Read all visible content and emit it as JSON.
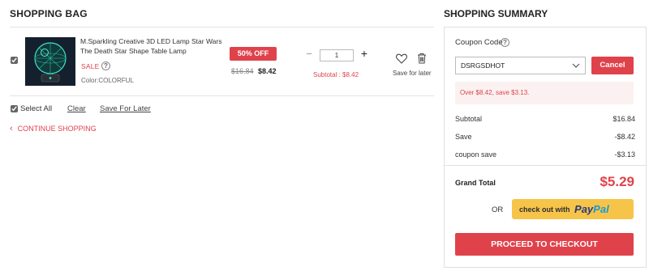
{
  "bag": {
    "title": "SHOPPING BAG",
    "item": {
      "name": "M.Sparkling Creative 3D LED Lamp Star Wars The Death Star Shape Table Lamp",
      "sale_label": "SALE",
      "color": "Color:COLORFUL",
      "discount_badge": "50% OFF",
      "old_price": "$16.84",
      "new_price": "$8.42",
      "quantity": "1",
      "subtotal": "Subtotal : $8.42",
      "save_for_later": "Save for later",
      "checked": true
    },
    "footer": {
      "select_all": "Select All",
      "clear": "Clear",
      "save_for_later": "Save For Later"
    },
    "continue_shopping": "CONTINUE SHOPPING"
  },
  "summary": {
    "title": "SHOPPING SUMMARY",
    "coupon_label": "Coupon Code",
    "coupon_value": "DSRGSDHOT",
    "cancel_label": "Cancel",
    "coupon_message": "Over $8.42, save $3.13.",
    "rows": [
      {
        "label": "Subtotal",
        "value": "$16.84"
      },
      {
        "label": "Save",
        "value": "-$8.42"
      },
      {
        "label": "coupon save",
        "value": "-$3.13"
      }
    ],
    "grand_total_label": "Grand Total",
    "grand_total_value": "$5.29",
    "or_label": "OR",
    "paypal_prefix": "check out with",
    "paypal_word_1": "Pay",
    "paypal_word_2": "Pal",
    "checkout_label": "PROCEED TO CHECKOUT"
  },
  "colors": {
    "accent": "#e0424b",
    "paypal_yellow": "#f7c44a",
    "paypal_dark_blue": "#253b80",
    "paypal_light_blue": "#179bd7"
  },
  "icons": [
    "help-icon",
    "heart-icon",
    "trash-icon",
    "chevron-left-icon",
    "chevron-down-icon"
  ]
}
